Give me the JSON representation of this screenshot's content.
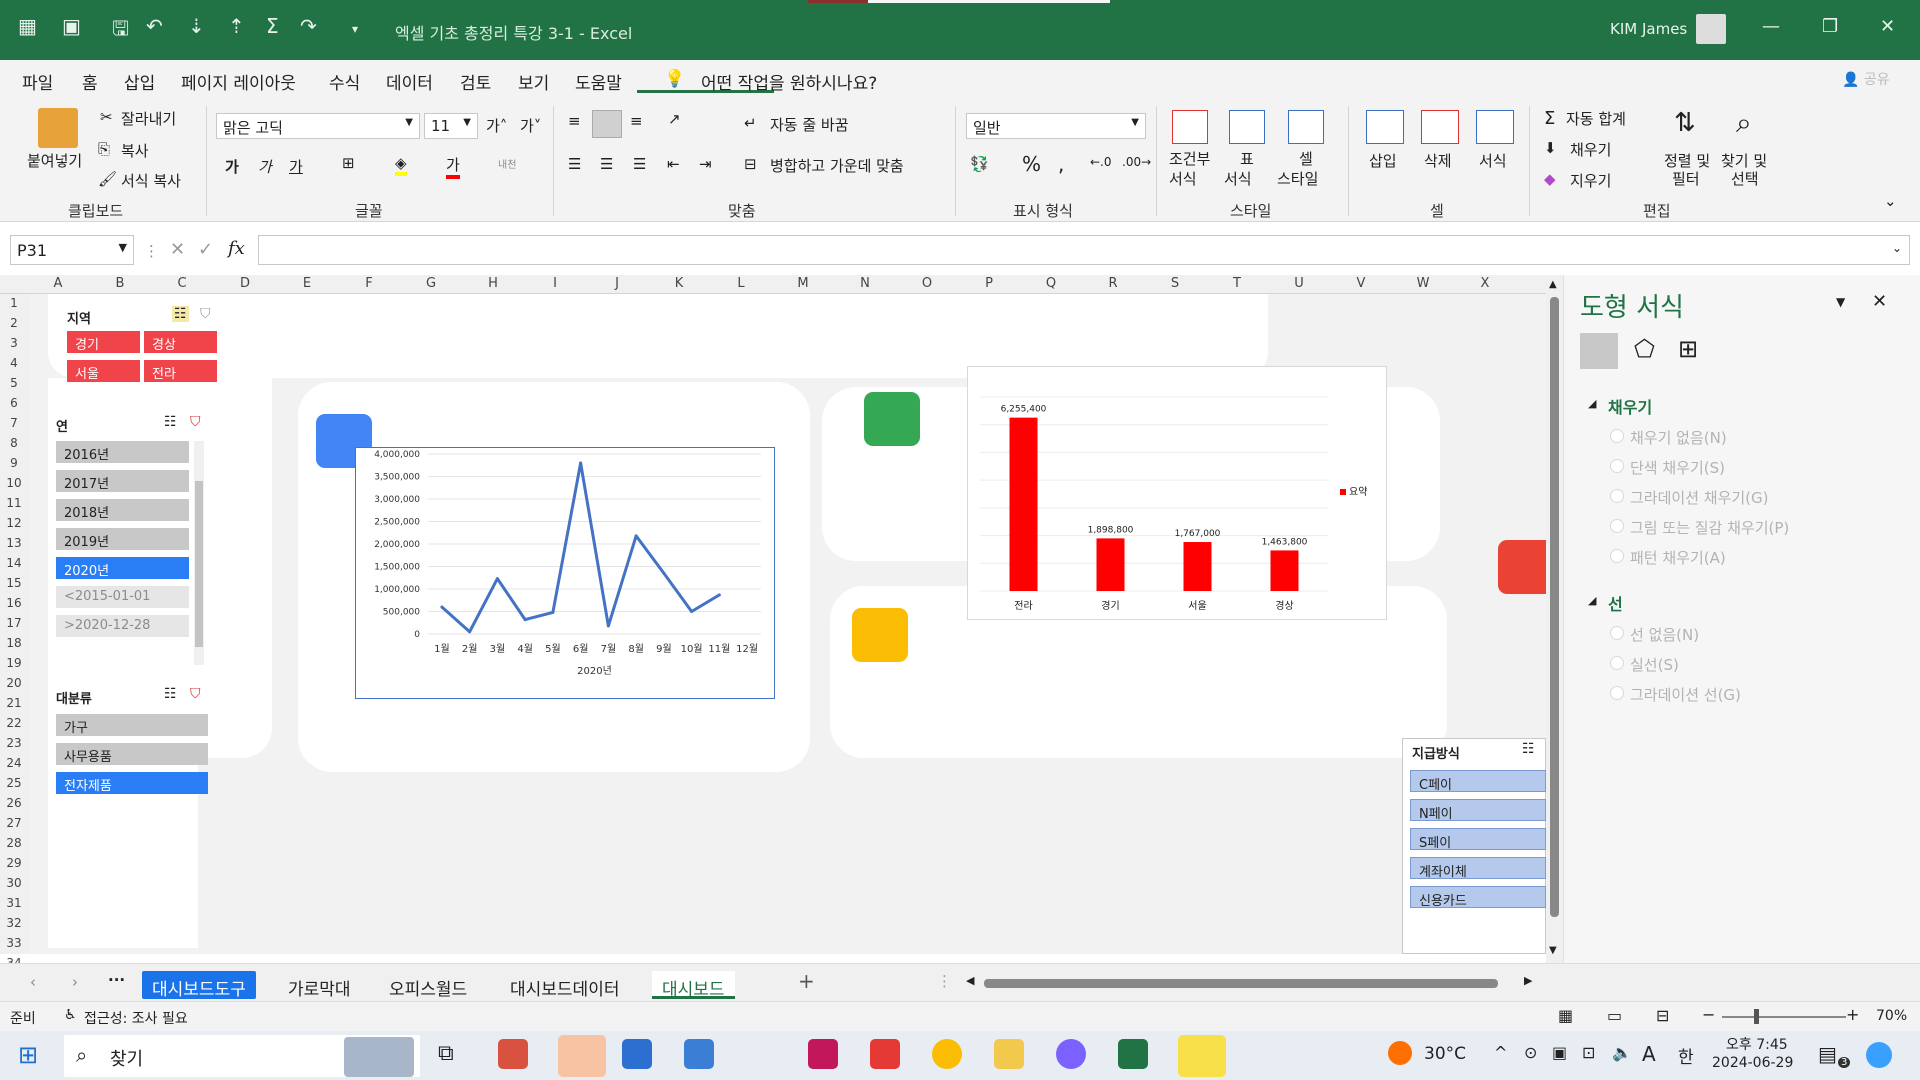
{
  "app": {
    "title": "엑셀 기초 총정리 특강 3-1  -  Excel",
    "user": "KIM James"
  },
  "menu": [
    "파일",
    "홈",
    "삽입",
    "페이지 레이아웃",
    "수식",
    "데이터",
    "검토",
    "보기",
    "도움말"
  ],
  "tell_me": "어떤 작업을 원하시나요?",
  "share": "공유",
  "ribbon": {
    "paste": "붙여넣기",
    "cut": "잘라내기",
    "copy": "복사",
    "format_painter": "서식 복사",
    "clipboard": "클립보드",
    "font_name": "맑은 고딕",
    "font_size": "11",
    "bold": "가",
    "italic": "가",
    "underline": "가",
    "font_group": "글꼴",
    "wrap_text": "자동 줄 바꿈",
    "merge_center": "병합하고 가운데 맞춤",
    "align_group": "맞춤",
    "number_format": "일반",
    "number_group": "표시 형식",
    "cond_format_1": "조건부",
    "cond_format_2": "서식",
    "table_fmt_1": "표",
    "table_fmt_2": "서식",
    "cell_style_1": "셀",
    "cell_style_2": "스타일",
    "styles_group": "스타일",
    "insert": "삽입",
    "delete": "삭제",
    "format": "서식",
    "cells_group": "셀",
    "autosum": "자동 합계",
    "fill": "채우기",
    "clear": "지우기",
    "sort_1": "정렬 및",
    "sort_2": "필터",
    "find_1": "찾기 및",
    "find_2": "선택",
    "editing_group": "편집"
  },
  "formula_bar": {
    "name_box": "P31",
    "fx": "fx",
    "formula": ""
  },
  "columns": [
    "A",
    "B",
    "C",
    "D",
    "E",
    "F",
    "G",
    "H",
    "I",
    "J",
    "K",
    "L",
    "M",
    "N",
    "O",
    "P",
    "Q",
    "R",
    "S",
    "T",
    "U",
    "V",
    "W",
    "X"
  ],
  "rows": [
    "1",
    "2",
    "3",
    "4",
    "5",
    "6",
    "7",
    "8",
    "9",
    "10",
    "11",
    "12",
    "13",
    "14",
    "15",
    "16",
    "17",
    "18",
    "19",
    "20",
    "21",
    "22",
    "23",
    "24",
    "25",
    "26",
    "27",
    "28",
    "29",
    "30",
    "31",
    "32",
    "33",
    "34"
  ],
  "slicers": {
    "region": {
      "title": "지역",
      "items": [
        "경기",
        "경상",
        "서울",
        "전라"
      ]
    },
    "year": {
      "title": "연",
      "items": [
        "2016년",
        "2017년",
        "2018년",
        "2019년",
        "2020년",
        "<2015-01-01",
        ">2020-12-28"
      ],
      "selected": "2020년"
    },
    "category": {
      "title": "대분류",
      "items": [
        "가구",
        "사무용품",
        "전자제품"
      ],
      "selected": "전자제품"
    },
    "payment": {
      "title": "지급방식",
      "items": [
        "C페이",
        "N페이",
        "S페이",
        "계좌이체",
        "신용카드"
      ]
    }
  },
  "chart_data": [
    {
      "type": "line",
      "x": [
        "1월",
        "2월",
        "3월",
        "4월",
        "5월",
        "6월",
        "7월",
        "8월",
        "9월",
        "10월",
        "11월",
        "12월"
      ],
      "series": [
        {
          "values": [
            600000,
            50000,
            1230000,
            320000,
            480000,
            3800000,
            180000,
            2180000,
            1350000,
            500000,
            870000
          ]
        }
      ],
      "xgroup": "2020년",
      "yticks": [
        "0",
        "500,000",
        "1,000,000",
        "1,500,000",
        "2,000,000",
        "2,500,000",
        "3,000,000",
        "3,500,000",
        "4,000,000"
      ],
      "ylim": [
        0,
        4000000
      ],
      "grid": true
    },
    {
      "type": "bar",
      "categories": [
        "전라",
        "경기",
        "서울",
        "경상"
      ],
      "values": [
        6255400,
        1898800,
        1767000,
        1463800
      ],
      "labels": [
        "6,255,400",
        "1,898,800",
        "1,767,000",
        "1,463,800"
      ],
      "legend": "요약",
      "legend_position": "right",
      "color": "#ff0000"
    }
  ],
  "pane": {
    "title": "도형 서식",
    "fill_section": "채우기",
    "fill_options": [
      "채우기 없음(N)",
      "단색 채우기(S)",
      "그라데이션 채우기(G)",
      "그림 또는 질감 채우기(P)",
      "패턴 채우기(A)"
    ],
    "line_section": "선",
    "line_options": [
      "선 없음(N)",
      "실선(S)",
      "그라데이션 선(G)"
    ]
  },
  "sheet_tabs": [
    "대시보드도구",
    "가로막대",
    "오피스월드",
    "대시보드데이터",
    "대시보드"
  ],
  "active_tab": "대시보드",
  "status": {
    "ready": "준비",
    "accessibility": "접근성: 조사 필요",
    "zoom": "70%"
  },
  "taskbar": {
    "search": "찾기",
    "weather": "30°C",
    "ime": "A",
    "lang": "한",
    "time": "오후 7:45",
    "date": "2024-06-29",
    "notif": "3"
  },
  "colors": {
    "excel_green": "#217346",
    "slicer_red": "#f0434a",
    "slicer_blue": "#2a7ef5",
    "line": "#4472c4",
    "bar": "#ff0000"
  }
}
